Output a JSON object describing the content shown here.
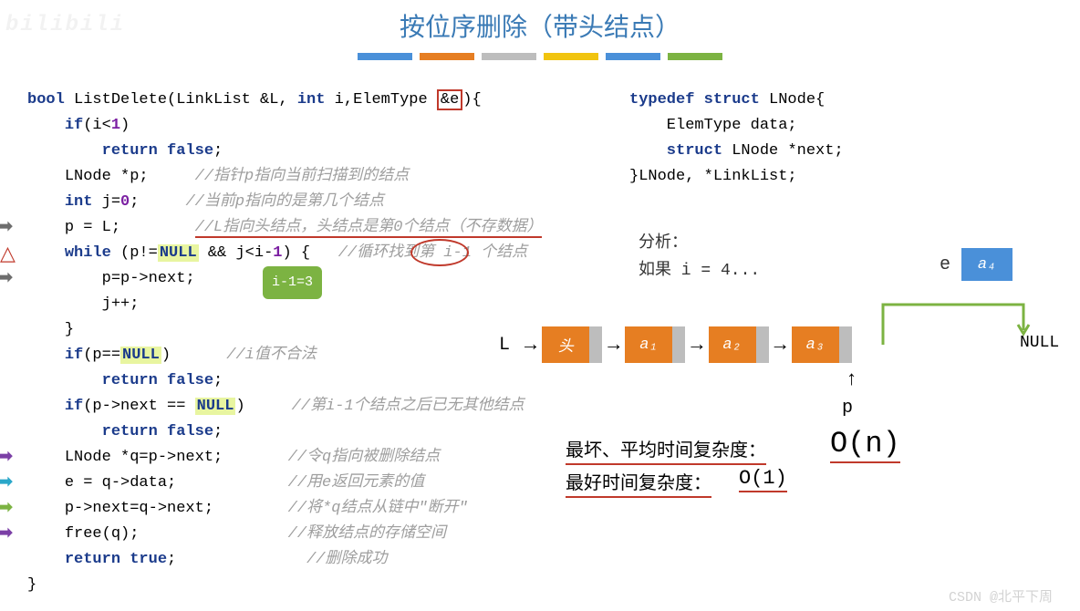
{
  "title": "按位序删除（带头结点）",
  "stripes": [
    "#4a90d9",
    "#e67e22",
    "#bdbdbd",
    "#f1c40f",
    "#4a90d9",
    "#7cb342"
  ],
  "code": {
    "l0_sig_a": "bool",
    "l0_sig_b": " ListDelete(LinkList &L, ",
    "l0_int": "int",
    "l0_sig_c": " i,ElemType ",
    "l0_amp": "&e",
    "l0_sig_d": "){",
    "l1_if": "if",
    "l1_cond": "(i<",
    "l1_1": "1",
    "l1_cond2": ")",
    "l2_return": "return false",
    "l2_semi": ";",
    "l3_a": "LNode *p;     ",
    "l3_c": "//指针p指向当前扫描到的结点",
    "l4_a": "int",
    "l4_b": " j=",
    "l4_0": "0",
    "l4_c": ";     ",
    "l4_cmt": "//当前p指向的是第几个结点",
    "l5_a": "p = L;        ",
    "l5_cmt": "//L指向头结点，头结点是第0个结点（不存数据）",
    "l6_while": "while",
    "l6_a": " (p!=",
    "l6_null": "NULL",
    "l6_b": " && j<i-",
    "l6_1": "1",
    "l6_c": ") {   ",
    "l6_cmt": "//循环找到第 i-1 个结点",
    "l7": "p=p->next;",
    "l8": "j++;",
    "l9": "}",
    "l10_if": "if",
    "l10_a": "(p==",
    "l10_null": "NULL",
    "l10_b": ")      ",
    "l10_cmt": "//i值不合法",
    "l11_return": "return false",
    "l11_semi": ";",
    "l12_if": "if",
    "l12_a": "(p->next == ",
    "l12_null": "NULL",
    "l12_b": ")     ",
    "l12_cmt": "//第i-1个结点之后已无其他结点",
    "l13_return": "return false",
    "l13_semi": ";",
    "l14_a": "LNode *q=p->next;       ",
    "l14_cmt": "//令q指向被删除结点",
    "l15_a": "e = q->data;            ",
    "l15_cmt": "//用e返回元素的值",
    "l16_a": "p->next=q->next;        ",
    "l16_cmt": "//将*q结点从链中\"断开\"",
    "l17_a": "free(q);                ",
    "l17_cmt": "//释放结点的存储空间",
    "l18_return": "return true",
    "l18_semi": ";              ",
    "l18_cmt": "//删除成功",
    "l19": "}"
  },
  "badge": "i-1=3",
  "typedef": {
    "l0_a": "typedef struct",
    "l0_b": " LNode{",
    "l1": "    ElemType data;",
    "l2_a": "    struct",
    "l2_b": " LNode *next;",
    "l3": "}LNode, *LinkList;"
  },
  "analysis": {
    "l0": "分析：",
    "l1": "如果 i = 4..."
  },
  "e_label": "e",
  "e_cell": "a₄",
  "ll": {
    "L": "L",
    "head": "头",
    "nodes": [
      "a₁",
      "a₂",
      "a₃"
    ],
    "null": "NULL",
    "p": "p"
  },
  "complexity": {
    "worst_avg_label": "最坏、平均时间复杂度：",
    "on": "O(n)",
    "best_label": "最好时间复杂度：",
    "o1": "O(1)"
  },
  "watermark_tl": "bilibili",
  "watermark_br": "CSDN @北平下周"
}
